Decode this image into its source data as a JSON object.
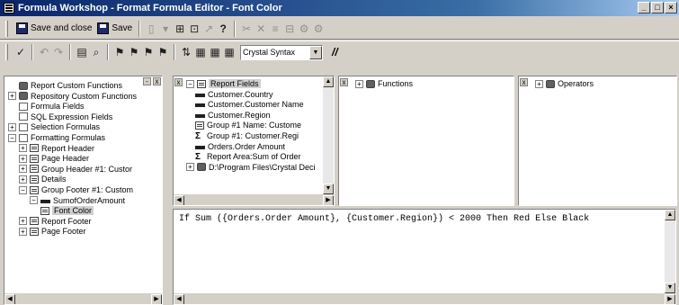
{
  "window": {
    "title": "Formula Workshop - Format Formula Editor - Font Color",
    "btn_min": "_",
    "btn_max": "□",
    "btn_close": "×"
  },
  "toolbar1": {
    "save_close": "Save and close",
    "save": "Save",
    "help": "?"
  },
  "toolbar2": {
    "syntax_value": "Crystal Syntax",
    "comment": "//"
  },
  "left_tree": [
    {
      "label": "Report Custom Functions",
      "level": 1,
      "icon": "gear-icon",
      "expander": ""
    },
    {
      "label": "Repository Custom Functions",
      "level": 0,
      "icon": "gear-icon",
      "expander": "+"
    },
    {
      "label": "Formula Fields",
      "level": 1,
      "icon": "folder-icon",
      "expander": ""
    },
    {
      "label": "SQL Expression Fields",
      "level": 1,
      "icon": "folder-icon",
      "expander": ""
    },
    {
      "label": "Selection Formulas",
      "level": 0,
      "icon": "folder-icon",
      "expander": "+"
    },
    {
      "label": "Formatting Formulas",
      "level": 0,
      "icon": "folder-icon",
      "expander": "−"
    },
    {
      "label": "Report Header",
      "level": 1,
      "icon": "doc-icon",
      "expander": "+"
    },
    {
      "label": "Page Header",
      "level": 1,
      "icon": "doc-icon",
      "expander": "+"
    },
    {
      "label": "Group Header #1: Custor",
      "level": 1,
      "icon": "doc-icon",
      "expander": "+"
    },
    {
      "label": "Details",
      "level": 1,
      "icon": "doc-icon",
      "expander": "+"
    },
    {
      "label": "Group Footer #1: Custom",
      "level": 1,
      "icon": "doc-icon",
      "expander": "−"
    },
    {
      "label": "SumofOrderAmount",
      "level": 2,
      "icon": "field-icon",
      "expander": "−"
    },
    {
      "label": "Font Color",
      "level": 3,
      "icon": "formula-icon",
      "expander": "",
      "selected": true
    },
    {
      "label": "Report Footer",
      "level": 1,
      "icon": "doc-icon",
      "expander": "+"
    },
    {
      "label": "Page Footer",
      "level": 1,
      "icon": "doc-icon",
      "expander": "+"
    }
  ],
  "fields_tree": [
    {
      "label": "Report Fields",
      "level": 0,
      "icon": "doc-icon",
      "expander": "−",
      "selected": true
    },
    {
      "label": "Customer.Country",
      "level": 1,
      "icon": "field-icon"
    },
    {
      "label": "Customer.Customer Name",
      "level": 1,
      "icon": "field-icon"
    },
    {
      "label": "Customer.Region",
      "level": 1,
      "icon": "field-icon"
    },
    {
      "label": "Group #1 Name: Custome",
      "level": 1,
      "icon": "group-icon"
    },
    {
      "label": "Group #1: Customer.Regi",
      "level": 1,
      "icon": "sigma-icon"
    },
    {
      "label": "Orders.Order Amount",
      "level": 1,
      "icon": "field-icon"
    },
    {
      "label": "Report Area:Sum of Order",
      "level": 1,
      "icon": "sigma-icon"
    },
    {
      "label": "D:\\Program Files\\Crystal Deci",
      "level": 0,
      "icon": "db-icon",
      "expander": "+"
    }
  ],
  "functions_pane": {
    "label": "Functions",
    "expander": "+"
  },
  "operators_pane": {
    "label": "Operators",
    "expander": "+"
  },
  "pane_close": "x",
  "editor": {
    "code": "If Sum ({Orders.Order Amount}, {Customer.Region}) < 2000 Then Red Else Black"
  },
  "scroll": {
    "left": "◀",
    "right": "▶",
    "up": "▲",
    "down": "▼"
  }
}
